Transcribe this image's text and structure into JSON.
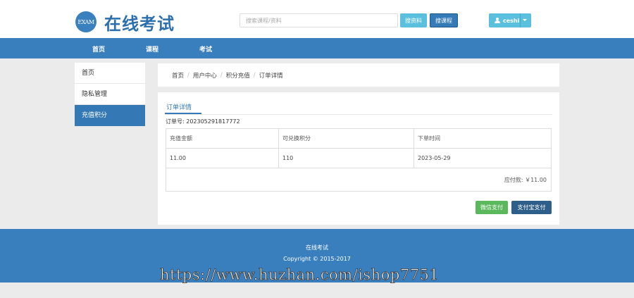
{
  "header": {
    "logo_badge": "EXAM",
    "logo_text": "在线考试",
    "search_placeholder": "搜索课程/资料",
    "search_material_label": "搜资料",
    "search_course_label": "搜课程",
    "username": "ceshi"
  },
  "nav": {
    "items": [
      {
        "label": "首页"
      },
      {
        "label": "课程"
      },
      {
        "label": "考试"
      }
    ]
  },
  "sidebar": {
    "items": [
      {
        "label": "首页"
      },
      {
        "label": "隐私管理"
      },
      {
        "label": "充值积分"
      }
    ],
    "active_index": 2
  },
  "breadcrumb": {
    "items": [
      "首页",
      "用户中心",
      "积分充值",
      "订单详情"
    ]
  },
  "order": {
    "tab_label": "订单详情",
    "order_no_label": "订单号: 202305291817772",
    "columns": [
      "充值金额",
      "可兑换积分",
      "下单时间"
    ],
    "row": [
      "11.00",
      "110",
      "2023-05-29"
    ],
    "total_label": "应付款: ￥11.00",
    "wechat_pay_label": "微信支付",
    "alipay_label": "支付宝支付"
  },
  "footer": {
    "title": "在线考试",
    "copyright": "Copyright © 2015-2017"
  },
  "watermark": "https://www.huzhan.com/ishop7751",
  "colors": {
    "brand_blue": "#3a7fbd",
    "info_cyan": "#5bc0de",
    "success_green": "#5cb85c",
    "dark_blue": "#2e5f8a"
  }
}
